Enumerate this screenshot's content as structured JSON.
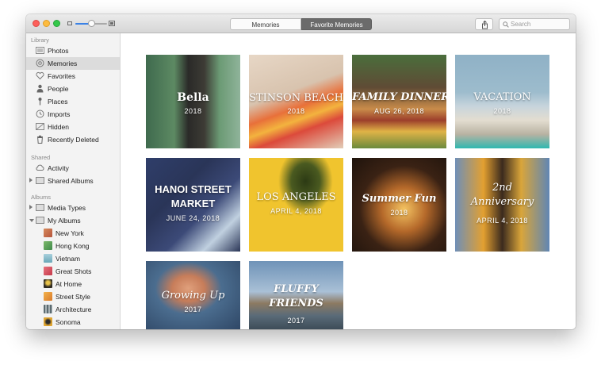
{
  "toolbar": {
    "tabs": [
      {
        "label": "Memories",
        "selected": false
      },
      {
        "label": "Favorite Memories",
        "selected": true
      }
    ],
    "search_placeholder": "Search"
  },
  "sidebar": {
    "library": {
      "header": "Library",
      "items": [
        {
          "label": "Photos",
          "icon": "photos-icon"
        },
        {
          "label": "Memories",
          "icon": "memories-icon",
          "selected": true
        },
        {
          "label": "Favorites",
          "icon": "heart-icon"
        },
        {
          "label": "People",
          "icon": "person-icon"
        },
        {
          "label": "Places",
          "icon": "pin-icon"
        },
        {
          "label": "Imports",
          "icon": "clock-icon"
        },
        {
          "label": "Hidden",
          "icon": "hidden-icon"
        },
        {
          "label": "Recently Deleted",
          "icon": "trash-icon"
        }
      ]
    },
    "shared": {
      "header": "Shared",
      "items": [
        {
          "label": "Activity",
          "icon": "cloud-icon"
        },
        {
          "label": "Shared Albums",
          "icon": "album-icon"
        }
      ]
    },
    "albums": {
      "header": "Albums",
      "items": [
        {
          "label": "Media Types",
          "icon": "album-icon"
        },
        {
          "label": "My Albums",
          "icon": "album-icon"
        },
        {
          "label": "New York",
          "color": "#b5543b"
        },
        {
          "label": "Hong Kong",
          "color": "#3f8a4a"
        },
        {
          "label": "Vietnam",
          "color": "#6aa7b8"
        },
        {
          "label": "Great Shots",
          "color": "#c4394a"
        },
        {
          "label": "At Home",
          "color": "#2f2a22"
        },
        {
          "label": "Street Style",
          "color": "#d97a2a"
        },
        {
          "label": "Architecture",
          "color": "#5c6b70"
        },
        {
          "label": "Sonoma",
          "color": "#e0a530"
        }
      ]
    }
  },
  "memories": [
    {
      "title": "Bella",
      "date": "2018"
    },
    {
      "title": "STINSON BEACH",
      "date": "2018"
    },
    {
      "title": "FAMILY DINNER",
      "date": "AUG 26, 2018"
    },
    {
      "title": "VACATION",
      "date": "2018"
    },
    {
      "title": "HANOI STREET",
      "title2": "MARKET",
      "date": "JUNE 24, 2018"
    },
    {
      "title": "LOS ANGELES",
      "date": "APRIL 4, 2018"
    },
    {
      "title": "Summer Fun",
      "date": "2018"
    },
    {
      "title": "2nd",
      "title2": "Anniversary",
      "date": "APRIL 4, 2018"
    },
    {
      "title": "Growing Up",
      "date": "2017"
    },
    {
      "title": "FLUFFY",
      "title2": "FRIENDS",
      "date": "2017"
    }
  ]
}
